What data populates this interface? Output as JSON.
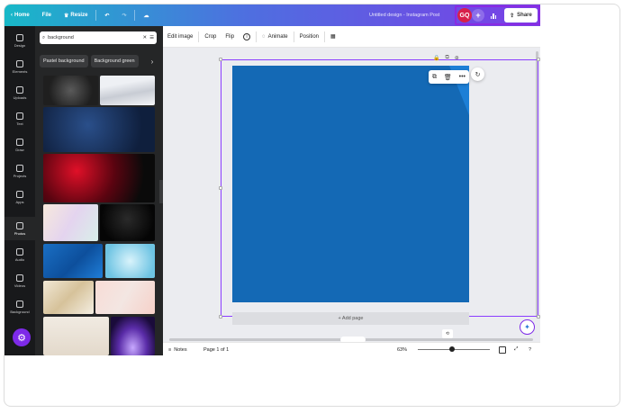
{
  "topbar": {
    "home": "Home",
    "file": "File",
    "resize": "Resize",
    "title": "Untitled design - Instagram Post",
    "avatar": "GQ",
    "plus": "+",
    "share": "Share"
  },
  "rail": {
    "items": [
      {
        "label": "Design",
        "icon": "design-icon"
      },
      {
        "label": "Elements",
        "icon": "elements-icon"
      },
      {
        "label": "Uploads",
        "icon": "upload-icon"
      },
      {
        "label": "Text",
        "icon": "text-icon"
      },
      {
        "label": "Draw",
        "icon": "draw-icon"
      },
      {
        "label": "Projects",
        "icon": "folder-icon"
      },
      {
        "label": "Apps",
        "icon": "apps-icon"
      },
      {
        "label": "Photos",
        "icon": "photos-icon"
      },
      {
        "label": "Audio",
        "icon": "audio-icon"
      },
      {
        "label": "Videos",
        "icon": "video-icon"
      },
      {
        "label": "Background",
        "icon": "background-icon"
      }
    ]
  },
  "panel": {
    "search_value": "background",
    "chips": [
      "Pastel background",
      "Background green"
    ]
  },
  "toolbar": {
    "edit_image": "Edit image",
    "crop": "Crop",
    "flip": "Flip",
    "info": "i",
    "animate": "Animate",
    "position": "Position"
  },
  "canvas": {
    "add_page": "+ Add page"
  },
  "bottombar": {
    "notes": "Notes",
    "page": "Page 1 of 1",
    "zoom": "63%"
  },
  "colors": {
    "accent": "#7d2ae8",
    "page_fill": "#1469b5"
  }
}
